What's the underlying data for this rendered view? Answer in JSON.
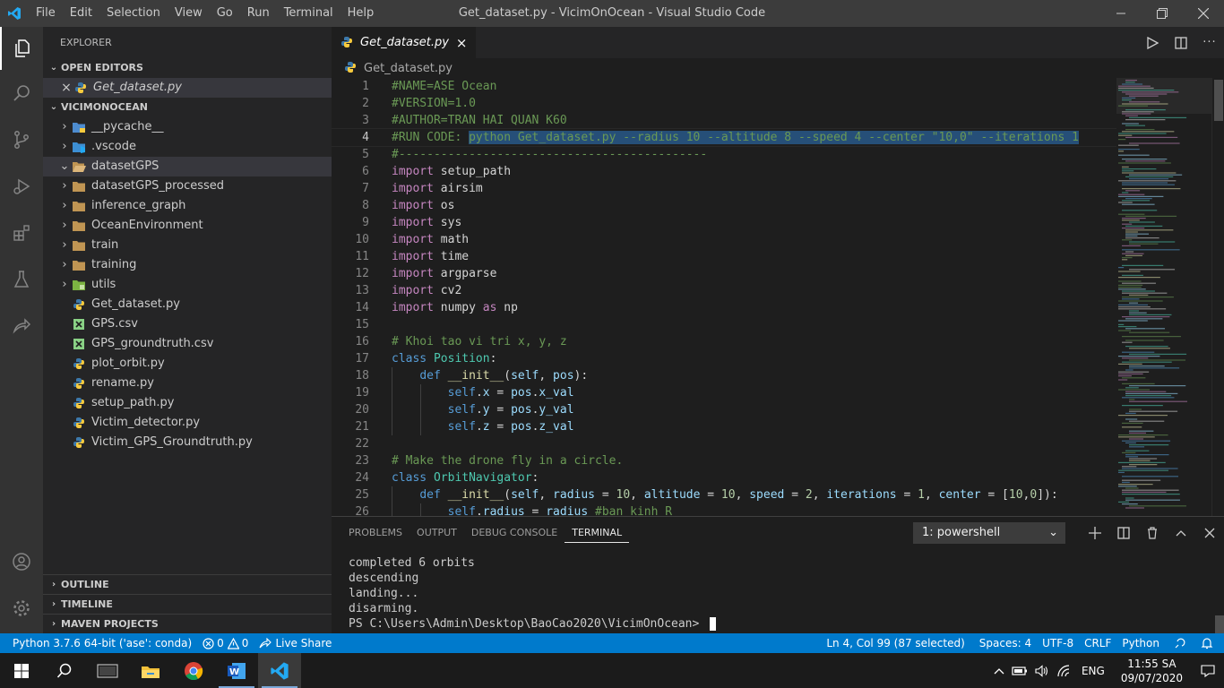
{
  "window": {
    "title": "Get_dataset.py - VicimOnOcean - Visual Studio Code",
    "menu": [
      "File",
      "Edit",
      "Selection",
      "View",
      "Go",
      "Run",
      "Terminal",
      "Help"
    ]
  },
  "sidebar": {
    "title": "EXPLORER",
    "open_editors_label": "OPEN EDITORS",
    "open_editors": [
      {
        "name": "Get_dataset.py"
      }
    ],
    "project_label": "VICIMONOCEAN",
    "tree": [
      {
        "name": "__pycache__",
        "kind": "folder"
      },
      {
        "name": ".vscode",
        "kind": "folder"
      },
      {
        "name": "datasetGPS",
        "kind": "folder-open"
      },
      {
        "name": "datasetGPS_processed",
        "kind": "folder"
      },
      {
        "name": "inference_graph",
        "kind": "folder"
      },
      {
        "name": "OceanEnvironment",
        "kind": "folder"
      },
      {
        "name": "train",
        "kind": "folder"
      },
      {
        "name": "training",
        "kind": "folder"
      },
      {
        "name": "utils",
        "kind": "folder"
      },
      {
        "name": "Get_dataset.py",
        "kind": "python"
      },
      {
        "name": "GPS.csv",
        "kind": "csv"
      },
      {
        "name": "GPS_groundtruth.csv",
        "kind": "csv"
      },
      {
        "name": "plot_orbit.py",
        "kind": "python"
      },
      {
        "name": "rename.py",
        "kind": "python"
      },
      {
        "name": "setup_path.py",
        "kind": "python"
      },
      {
        "name": "Victim_detector.py",
        "kind": "python"
      },
      {
        "name": "Victim_GPS_Groundtruth.py",
        "kind": "python"
      }
    ],
    "outline_label": "OUTLINE",
    "timeline_label": "TIMELINE",
    "maven_label": "MAVEN PROJECTS"
  },
  "editor": {
    "tab_label": "Get_dataset.py",
    "breadcrumb": "Get_dataset.py",
    "line_numbers": [
      "1",
      "2",
      "3",
      "4",
      "5",
      "6",
      "7",
      "8",
      "9",
      "10",
      "11",
      "12",
      "13",
      "14",
      "15",
      "16",
      "17",
      "18",
      "19",
      "20",
      "21",
      "22",
      "23",
      "24",
      "25",
      "26"
    ],
    "lines": {
      "l1": "#NAME=ASE Ocean",
      "l2": "#VERSION=1.0",
      "l3": "#AUTHOR=TRAN HAI QUAN K60",
      "l4a": "#RUN CODE: ",
      "l4b": "python Get_dataset.py --radius 10 --altitude 8 --speed 4 --center \"10,0\" --iterations 1",
      "l5": "#--------------------------------------------",
      "imports": [
        "setup_path",
        "airsim",
        "os",
        "sys",
        "math",
        "time",
        "argparse",
        "cv2",
        "numpy"
      ],
      "kw_import": "import",
      "kw_as": "as",
      "np": "np",
      "l16": "# Khoi tao vi tri x, y, z",
      "kw_class": "class",
      "cls_position": "Position",
      "kw_def": "def",
      "fn_init": "__init__",
      "kw_self": "self",
      "p_pos": "pos",
      "attr_x": "x",
      "attr_y": "y",
      "attr_z": "z",
      "val_x": "x_val",
      "val_y": "y_val",
      "val_z": "z_val",
      "l23": "# Make the drone fly in a circle.",
      "cls_orbit": "OrbitNavigator",
      "p_radius": "radius",
      "p_altitude": "altitude",
      "p_speed": "speed",
      "p_iterations": "iterations",
      "p_center": "center",
      "n10": "10",
      "n2": "2",
      "n1": "1",
      "n0": "0",
      "l26_comment": "#ban kinh R"
    }
  },
  "panel": {
    "tabs": [
      "PROBLEMS",
      "OUTPUT",
      "DEBUG CONSOLE",
      "TERMINAL"
    ],
    "active_tab": "TERMINAL",
    "terminal_select": "1: powershell",
    "terminal_lines": [
      "completed 6 orbits",
      "descending",
      "landing...",
      "disarming.",
      "PS C:\\Users\\Admin\\Desktop\\BaoCao2020\\VicimOnOcean> "
    ]
  },
  "statusbar": {
    "interpreter": "Python 3.7.6 64-bit ('ase': conda)",
    "errors": "0",
    "warnings": "0",
    "live_share": "Live Share",
    "position": "Ln 4, Col 99 (87 selected)",
    "spaces": "Spaces: 4",
    "encoding": "UTF-8",
    "eol": "CRLF",
    "language": "Python"
  },
  "taskbar": {
    "language": "ENG",
    "time": "11:55 SA",
    "date": "09/07/2020"
  },
  "colors": {
    "accent": "#007acc",
    "comment": "#6a9955",
    "keyword": "#c586c0",
    "class": "#4ec9b0",
    "function": "#dcdcaa",
    "variable": "#9cdcfe",
    "number": "#b5cea8"
  }
}
